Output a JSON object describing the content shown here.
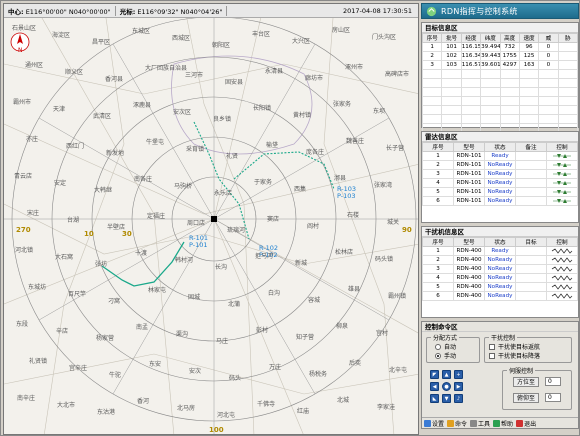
{
  "app": {
    "title": "RDN指挥与控制系统"
  },
  "coordbar": {
    "center_label": "中心:",
    "center_value": "E116°00'00\"  N040°00'00\"",
    "cursor_label": "光标:",
    "cursor_value": "E116°09'32\"  N040°04'26\"",
    "time": "2017-04-08 17:30:51"
  },
  "map": {
    "compass": "N",
    "ring_labels": [
      "270",
      "10",
      "30",
      "100",
      "90"
    ],
    "places": [
      "石景山区",
      "海淀区",
      "昌平区",
      "东城区",
      "西城区",
      "朝阳区",
      "丰台区",
      "大兴区",
      "房山区",
      "门头沟区",
      "通州区",
      "顺义区",
      "香河县",
      "大厂回族自治县",
      "三河市",
      "固安县",
      "永清县",
      "廊坊市",
      "涿州市",
      "高碑店市",
      "霸州市",
      "天津",
      "武清区",
      "涿鹿县",
      "安次区",
      "良乡镇",
      "长阳镇",
      "黄村镇",
      "张家务",
      "东坝",
      "亦庄",
      "西红门",
      "新发地",
      "牛堡屯",
      "采育镇",
      "礼贤",
      "榆垡",
      "庞各庄",
      "魏善庄",
      "长子营",
      "青云店",
      "安定",
      "大韩继",
      "南各庄",
      "马驹桥",
      "永乐店",
      "于家务",
      "西集",
      "漷县",
      "张家湾",
      "宋庄",
      "台湖",
      "半壁店",
      "定福庄",
      "周口店",
      "琉璃河",
      "窦店",
      "阎村",
      "石楼",
      "城关",
      "河北镇",
      "大石窝",
      "张坊",
      "十渡",
      "韩村河",
      "长沟",
      "拒马河",
      "新城",
      "松林店",
      "码头镇",
      "东城坊",
      "百尺竿",
      "刁窝",
      "林家屯",
      "固城",
      "北蒲",
      "白沟",
      "容城",
      "雄县",
      "霸州镇",
      "东段",
      "辛店",
      "杨家营",
      "南孟",
      "渠沟",
      "马庄",
      "彭村",
      "知子营",
      "柳泉",
      "宫村",
      "礼贤镇",
      "宫辛庄",
      "牛驼",
      "东安",
      "安次",
      "码头",
      "万庄",
      "杨税务",
      "后奕",
      "北辛屯",
      "南辛庄",
      "大北市",
      "东沽港",
      "香河",
      "北马房",
      "河北屯",
      "千佛寺",
      "红庙",
      "北城",
      "李家洼"
    ],
    "tracks": [
      {
        "id": "R-103",
        "pair": "P-103"
      },
      {
        "id": "R-102",
        "pair": "P-102"
      },
      {
        "id": "R-101",
        "pair": "P-101"
      }
    ]
  },
  "target_section": {
    "title": "目标信息区",
    "headers": [
      "序号",
      "批号",
      "经度",
      "纬度",
      "高度",
      "速度",
      "威",
      "胁"
    ],
    "rows": [
      [
        "1",
        "101",
        "116.1553",
        "39.4947",
        "732",
        "96",
        "0",
        ""
      ],
      [
        "2",
        "102",
        "116.3496",
        "39.4432",
        "1755",
        "125",
        "0",
        ""
      ],
      [
        "3",
        "103",
        "116.572",
        "39.6014",
        "4297",
        "163",
        "0",
        ""
      ]
    ]
  },
  "radar_section": {
    "title": "雷达信息区",
    "headers": [
      "序号",
      "型号",
      "状态",
      "备注",
      "控制"
    ],
    "rows": [
      [
        "1",
        "RDN-101",
        "Ready",
        ""
      ],
      [
        "2",
        "RDN-101",
        "NoReady",
        ""
      ],
      [
        "3",
        "RDN-101",
        "NoReady",
        ""
      ],
      [
        "4",
        "RDN-101",
        "NoReady",
        ""
      ],
      [
        "5",
        "RDN-101",
        "NoReady",
        ""
      ],
      [
        "6",
        "RDN-101",
        "NoReady",
        ""
      ]
    ]
  },
  "jammer_section": {
    "title": "干扰机信息区",
    "headers": [
      "序号",
      "型号",
      "状态",
      "目标",
      "控制"
    ],
    "rows": [
      [
        "1",
        "RDN-400",
        "Ready",
        ""
      ],
      [
        "2",
        "RDN-400",
        "NoReady",
        ""
      ],
      [
        "3",
        "RDN-400",
        "NoReady",
        ""
      ],
      [
        "4",
        "RDN-400",
        "NoReady",
        ""
      ],
      [
        "5",
        "RDN-400",
        "NoReady",
        ""
      ],
      [
        "6",
        "RDN-400",
        "NoReady",
        ""
      ]
    ]
  },
  "control_section": {
    "title": "控制命令区",
    "mode_group": "分配方式",
    "mode_auto": "自动",
    "mode_manual": "手动",
    "jam_group": "干扰控制",
    "jam_opt1": "干扰使目标返航",
    "jam_opt2": "干扰使目标降落",
    "servo_group": "伺服控制",
    "azimuth_label": "方位至",
    "azimuth_value": "0",
    "pitch_label": "俯仰至",
    "pitch_value": "0"
  },
  "toolbar": {
    "settings": "设置",
    "command": "命令",
    "tools": "工具",
    "help": "帮助",
    "exit": "退出"
  },
  "colors": {
    "title_bg": "#1e6b8c",
    "track": "#1aa88a",
    "ready": "#1b3ec9",
    "ctrl_green": "#2e7d32"
  }
}
